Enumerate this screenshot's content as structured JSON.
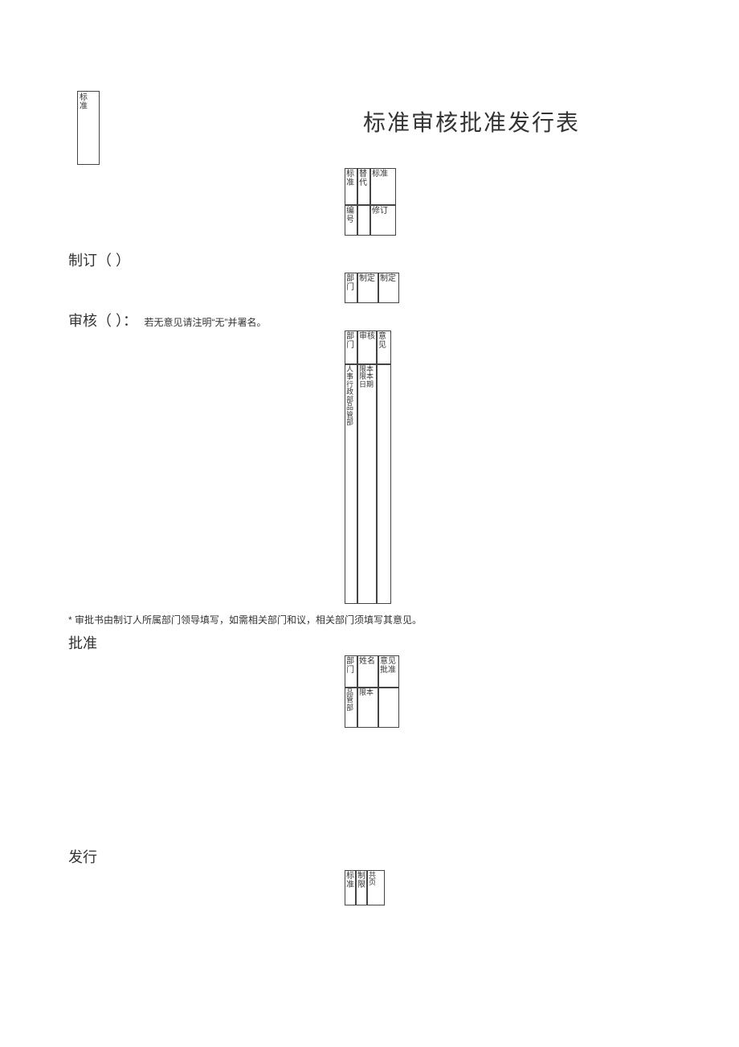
{
  "title": "标准审核批准发行表",
  "logo_box": "标准",
  "sections": {
    "establish": {
      "label": "制订（ ）"
    },
    "review": {
      "label": "审核（ ）：",
      "note": "若无意见请注明“无”并署名。"
    },
    "reviewer_note": "* 审批书由制订人所属部门领导填写，如需相关部门和议，相关部门须填写其意见。",
    "approve": {
      "label": "批准"
    },
    "issue": {
      "label": "发行"
    }
  },
  "table1": {
    "r1c1": "标准",
    "r1c2": "替代",
    "r1c3": "标准",
    "r2c1": "编号",
    "r2c2": "",
    "r2c3": "修订"
  },
  "table2": {
    "c1": "部门",
    "c2": "制定",
    "c3": "制定"
  },
  "table3": {
    "h1": "部门",
    "h2": "审核",
    "h3": "意见",
    "b1": "人事行政部 品管部",
    "b2": "限本 限本 日期",
    "b3": ""
  },
  "table4": {
    "r1c1": "部门",
    "r1c2": "姓名",
    "r1c3": "意见批准",
    "r2c1": "品管部",
    "r2c2": "限本",
    "r2c3": ""
  },
  "table5": {
    "c1": "标准",
    "c2": "制限",
    "c3": "共 页"
  }
}
